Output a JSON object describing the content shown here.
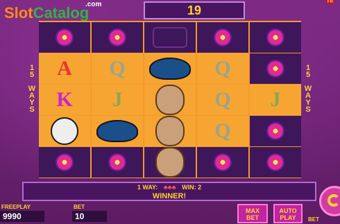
{
  "logo": {
    "slot": "Slot",
    "catalog": "Catalog",
    "com": ".com"
  },
  "counter": "19",
  "top_right_badge": "FR",
  "side_left": "15 WAYS",
  "side_right": "15 WAYS",
  "reels": [
    [
      "flower",
      "A",
      "K",
      "skull",
      "flower"
    ],
    [
      "flower",
      "Q",
      "J",
      "sombrero",
      "flower"
    ],
    [
      "cat",
      "sombrero",
      "girl",
      "girl",
      "girl"
    ],
    [
      "flower",
      "Q",
      "Q",
      "Q",
      "flower"
    ],
    [
      "flower",
      "flower",
      "J",
      "flower",
      "flower"
    ]
  ],
  "message": {
    "line1": "1 WAY:",
    "win_label": "WIN: 2",
    "line2": "WINNER!"
  },
  "freeplay": {
    "label": "FREEPLAY",
    "value": "9990"
  },
  "bet": {
    "label": "BET",
    "value": "10"
  },
  "bet_small_label": "BET",
  "buttons": {
    "max_bet": "MAX BET",
    "auto_play": "AUTO PLAY"
  }
}
